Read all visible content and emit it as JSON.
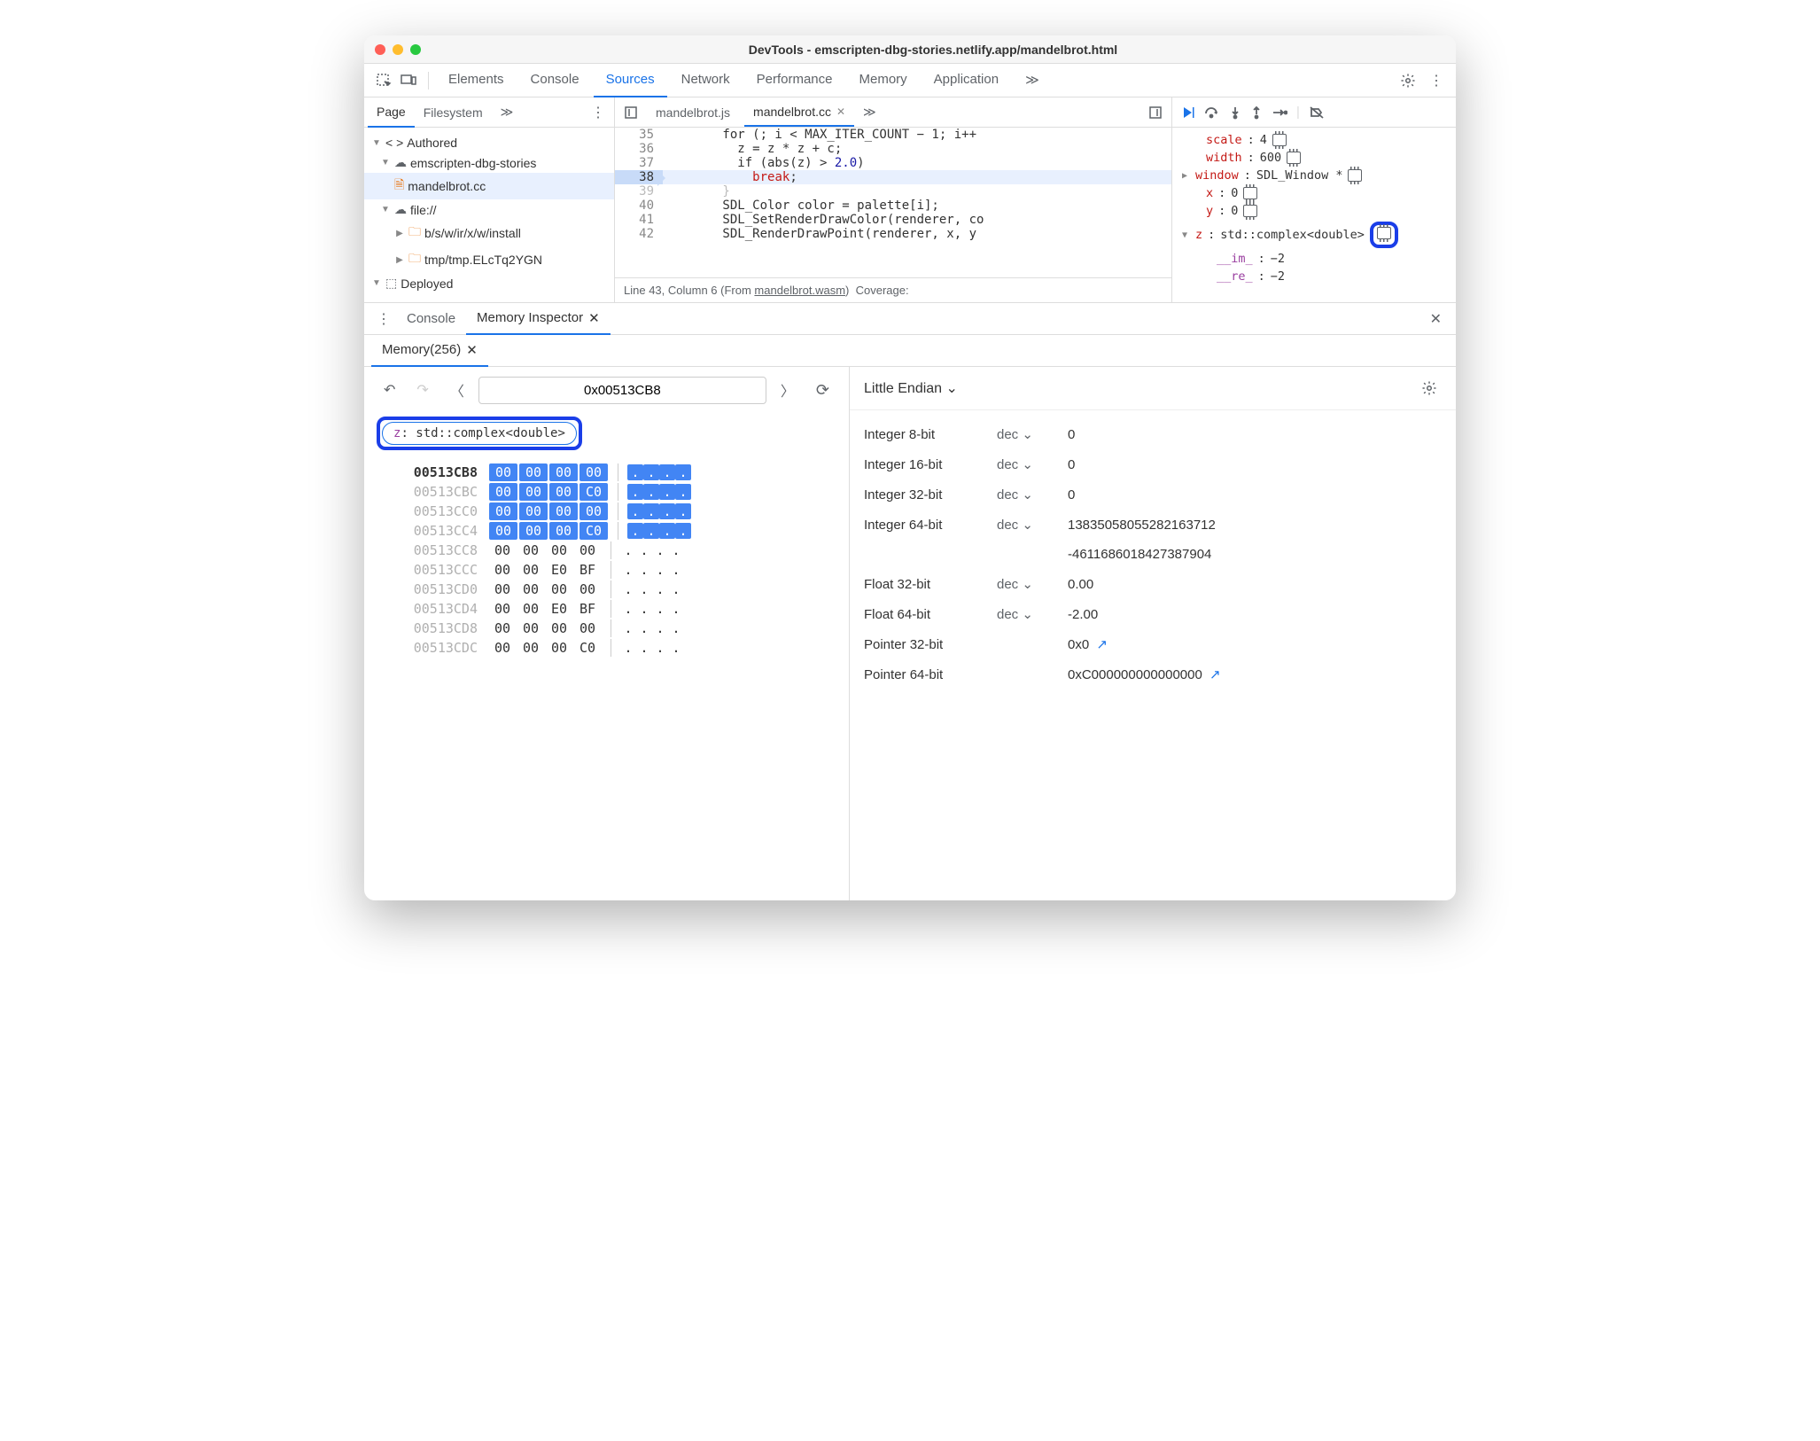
{
  "window": {
    "title": "DevTools - emscripten-dbg-stories.netlify.app/mandelbrot.html"
  },
  "toolbar": {
    "tabs": [
      "Elements",
      "Console",
      "Sources",
      "Network",
      "Performance",
      "Memory",
      "Application"
    ],
    "active": "Sources",
    "overflow": "≫"
  },
  "sidebar": {
    "tabs": [
      "Page",
      "Filesystem"
    ],
    "active": "Page",
    "overflow": "≫",
    "tree": {
      "authored": "Authored",
      "site": "emscripten-dbg-stories",
      "file": "mandelbrot.cc",
      "fileurl": "file://",
      "install": "b/s/w/ir/x/w/install",
      "tmp": "tmp/tmp.ELcTq2YGN",
      "deployed": "Deployed"
    }
  },
  "editor": {
    "tabs": [
      "mandelbrot.js",
      "mandelbrot.cc"
    ],
    "active": "mandelbrot.cc",
    "overflow": "≫",
    "lines": [
      {
        "n": 35,
        "text_pre": "        for (; i < MAX_ITER_COUNT − 1; i++"
      },
      {
        "n": 36,
        "text_pre": "          z = z * z + c;"
      },
      {
        "n": 37,
        "text_pre": "          if (abs(z) > ",
        "num": "2.0",
        "post": ")"
      },
      {
        "n": 38,
        "text_pre": "            ",
        "kw": "break",
        "post": ";"
      },
      {
        "n": 39,
        "text_pre": "        }"
      },
      {
        "n": 40,
        "text_pre": "        SDL_Color color = palette[i];"
      },
      {
        "n": 41,
        "text_pre": "        SDL_SetRenderDrawColor(renderer, co"
      },
      {
        "n": 42,
        "text_pre": "        SDL_RenderDrawPoint(renderer, x, y"
      }
    ],
    "status": {
      "pos": "Line 43, Column 6",
      "from": "(From ",
      "link": "mandelbrot.wasm",
      "post": ")",
      "cov": "Coverage:"
    }
  },
  "debugger": {
    "scope": {
      "scale": {
        "k": "scale",
        "v": "4"
      },
      "width": {
        "k": "width",
        "v": "600"
      },
      "windowv": {
        "k": "window",
        "v": "SDL_Window *"
      },
      "x": {
        "k": "x",
        "v": "0"
      },
      "y": {
        "k": "y",
        "v": "0"
      },
      "z": {
        "k": "z",
        "v": "std::complex<double>"
      },
      "im": {
        "k": "__im_",
        "v": "−2"
      },
      "re": {
        "k": "__re_",
        "v": "−2"
      }
    }
  },
  "drawer": {
    "tabs": [
      "Console",
      "Memory Inspector"
    ],
    "active": "Memory Inspector"
  },
  "memory": {
    "tab": "Memory(256)",
    "address": "0x00513CB8",
    "chip": {
      "prefix": "z",
      "rest": ": std::complex<double>"
    },
    "rows": [
      {
        "addr": "00513CB8",
        "bold": true,
        "bytes": [
          "00",
          "00",
          "00",
          "00"
        ],
        "hi": true,
        "ascii": [
          ".",
          ".",
          ".",
          "."
        ]
      },
      {
        "addr": "00513CBC",
        "bytes": [
          "00",
          "00",
          "00",
          "C0"
        ],
        "hi": true,
        "ascii": [
          ".",
          ".",
          ".",
          "."
        ]
      },
      {
        "addr": "00513CC0",
        "bytes": [
          "00",
          "00",
          "00",
          "00"
        ],
        "hi": true,
        "ascii": [
          ".",
          ".",
          ".",
          "."
        ]
      },
      {
        "addr": "00513CC4",
        "bytes": [
          "00",
          "00",
          "00",
          "C0"
        ],
        "hi": true,
        "ascii": [
          ".",
          ".",
          ".",
          "."
        ]
      },
      {
        "addr": "00513CC8",
        "bytes": [
          "00",
          "00",
          "00",
          "00"
        ],
        "hi": false,
        "ascii": [
          ".",
          ".",
          ".",
          "."
        ]
      },
      {
        "addr": "00513CCC",
        "bytes": [
          "00",
          "00",
          "E0",
          "BF"
        ],
        "hi": false,
        "ascii": [
          ".",
          ".",
          ".",
          "."
        ]
      },
      {
        "addr": "00513CD0",
        "bytes": [
          "00",
          "00",
          "00",
          "00"
        ],
        "hi": false,
        "ascii": [
          ".",
          ".",
          ".",
          "."
        ]
      },
      {
        "addr": "00513CD4",
        "bytes": [
          "00",
          "00",
          "E0",
          "BF"
        ],
        "hi": false,
        "ascii": [
          ".",
          ".",
          ".",
          "."
        ]
      },
      {
        "addr": "00513CD8",
        "bytes": [
          "00",
          "00",
          "00",
          "00"
        ],
        "hi": false,
        "ascii": [
          ".",
          ".",
          ".",
          "."
        ]
      },
      {
        "addr": "00513CDC",
        "bytes": [
          "00",
          "00",
          "00",
          "C0"
        ],
        "hi": false,
        "ascii": [
          ".",
          ".",
          ".",
          "."
        ]
      }
    ],
    "right": {
      "endian": "Little Endian",
      "rows": [
        {
          "label": "Integer 8-bit",
          "enc": "dec",
          "val": "0"
        },
        {
          "label": "Integer 16-bit",
          "enc": "dec",
          "val": "0"
        },
        {
          "label": "Integer 32-bit",
          "enc": "dec",
          "val": "0"
        },
        {
          "label": "Integer 64-bit",
          "enc": "dec",
          "val": "13835058055282163712"
        },
        {
          "label": "",
          "enc": "",
          "val": "-4611686018427387904"
        },
        {
          "label": "Float 32-bit",
          "enc": "dec",
          "val": "0.00"
        },
        {
          "label": "Float 64-bit",
          "enc": "dec",
          "val": "-2.00"
        },
        {
          "label": "Pointer 32-bit",
          "enc": "",
          "val": "0x0",
          "ext": true
        },
        {
          "label": "Pointer 64-bit",
          "enc": "",
          "val": "0xC000000000000000",
          "ext": true
        }
      ]
    }
  }
}
